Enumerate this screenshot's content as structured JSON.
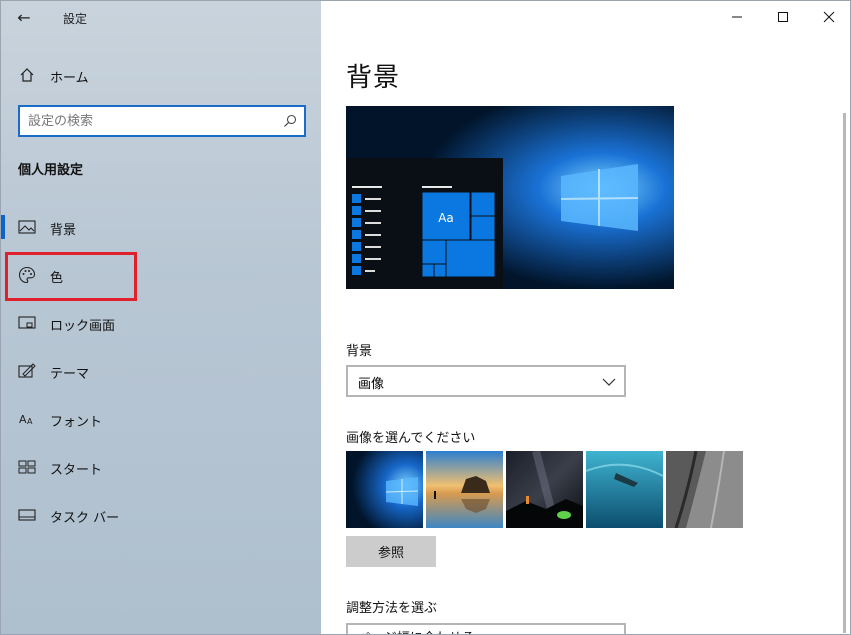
{
  "app": {
    "title": "設定",
    "back_icon": "back-arrow-icon"
  },
  "sidebar": {
    "home_label": "ホーム",
    "search_placeholder": "設定の検索",
    "section_title": "個人用設定",
    "items": [
      {
        "label": "背景",
        "icon": "picture-icon",
        "selected": true
      },
      {
        "label": "色",
        "icon": "palette-icon",
        "selected": false,
        "highlighted": true
      },
      {
        "label": "ロック画面",
        "icon": "lock-screen-icon",
        "selected": false
      },
      {
        "label": "テーマ",
        "icon": "theme-icon",
        "selected": false
      },
      {
        "label": "フォント",
        "icon": "font-icon",
        "selected": false
      },
      {
        "label": "スタート",
        "icon": "start-icon",
        "selected": false
      },
      {
        "label": "タスク バー",
        "icon": "taskbar-icon",
        "selected": false
      }
    ]
  },
  "window_controls": {
    "minimize": "—",
    "maximize": "☐",
    "close": "✕"
  },
  "main": {
    "title": "背景",
    "preview_tile_text": "Aa",
    "background_label": "背景",
    "background_value": "画像",
    "choose_picture_label": "画像を選んでください",
    "browse_label": "参照",
    "fit_label": "調整方法を選ぶ",
    "fit_value": "ページ幅に合わせる"
  },
  "colors": {
    "accent": "#0a64c8",
    "highlight": "#e0202a"
  }
}
